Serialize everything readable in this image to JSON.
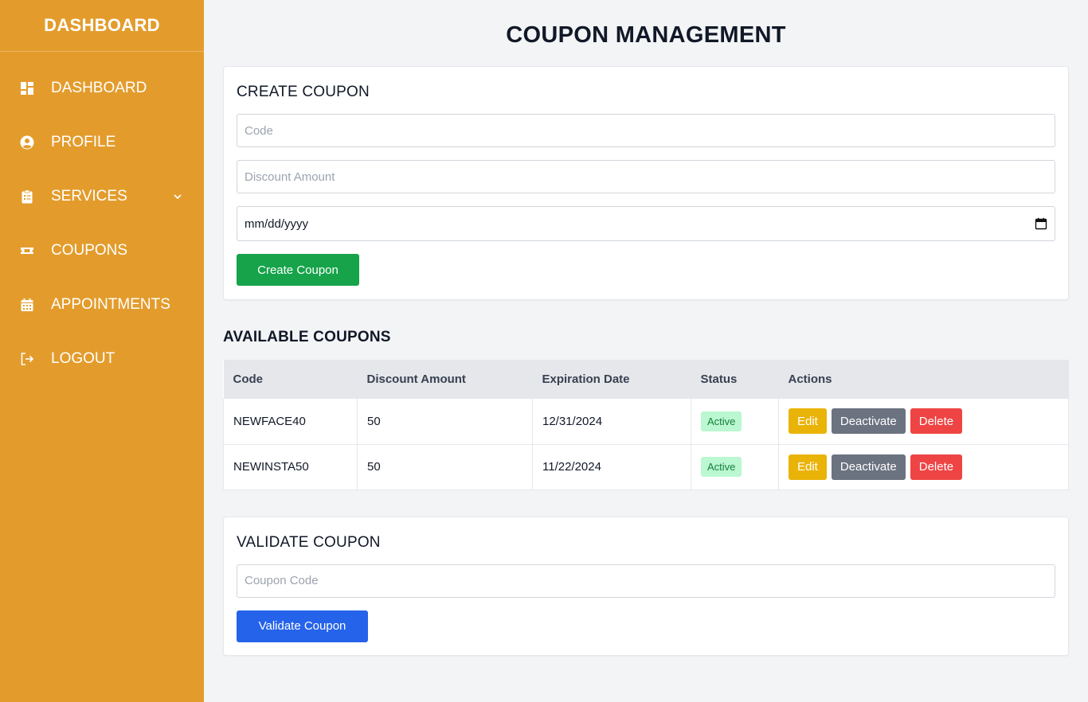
{
  "sidebar": {
    "brand": "DASHBOARD",
    "items": [
      {
        "label": "DASHBOARD",
        "icon": "dashboard-icon"
      },
      {
        "label": "PROFILE",
        "icon": "user-circle-icon"
      },
      {
        "label": "SERVICES",
        "icon": "clipboard-icon",
        "has_submenu": true
      },
      {
        "label": "COUPONS",
        "icon": "ticket-icon"
      },
      {
        "label": "APPOINTMENTS",
        "icon": "calendar-icon"
      },
      {
        "label": "LOGOUT",
        "icon": "logout-icon"
      }
    ]
  },
  "page": {
    "title": "COUPON MANAGEMENT"
  },
  "create": {
    "title": "CREATE COUPON",
    "code_placeholder": "Code",
    "discount_placeholder": "Discount Amount",
    "date_value": "mm/dd/yyyy",
    "button": "Create Coupon"
  },
  "coupons": {
    "title": "AVAILABLE COUPONS",
    "headers": [
      "Code",
      "Discount Amount",
      "Expiration Date",
      "Status",
      "Actions"
    ],
    "rows": [
      {
        "code": "NEWFACE40",
        "discount": "50",
        "expiration": "12/31/2024",
        "status": "Active"
      },
      {
        "code": "NEWINSTA50",
        "discount": "50",
        "expiration": "11/22/2024",
        "status": "Active"
      }
    ],
    "actions": {
      "edit": "Edit",
      "deactivate": "Deactivate",
      "delete": "Delete"
    }
  },
  "validate": {
    "title": "VALIDATE COUPON",
    "code_placeholder": "Coupon Code",
    "button": "Validate Coupon"
  },
  "colors": {
    "sidebar": "#e39c2c",
    "create_button": "#16a34a",
    "validate_button": "#2563eb",
    "edit_button": "#eab308",
    "deactivate_button": "#6b7280",
    "delete_button": "#ef4444",
    "badge_active": "#bbf7d0"
  }
}
